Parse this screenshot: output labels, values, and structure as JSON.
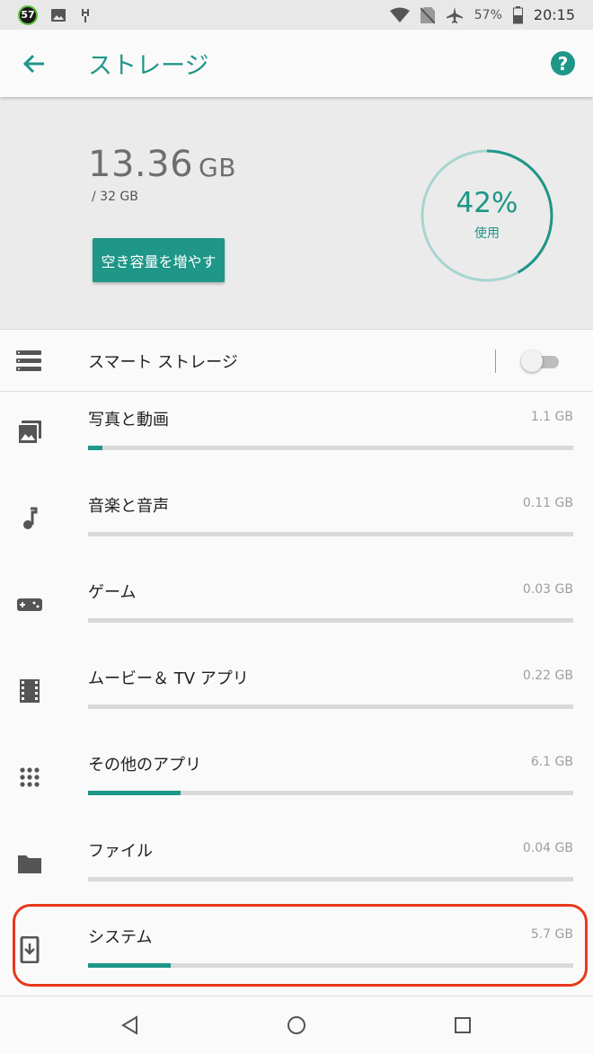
{
  "status_bar": {
    "badge": "57",
    "battery_pct": "57%",
    "time": "20:15",
    "icons": [
      "badge-icon",
      "image-icon",
      "usb-icon",
      "wifi-icon",
      "no-sim-icon",
      "airplane-icon",
      "battery-icon"
    ]
  },
  "app_bar": {
    "title": "ストレージ",
    "help_glyph": "?"
  },
  "summary": {
    "used_value": "13.36",
    "used_unit": "GB",
    "total": "/ 32 GB",
    "free_up_button": "空き容量を増やす",
    "gauge_percent": "42%",
    "gauge_label": "使用",
    "gauge_fraction": 0.42
  },
  "smart_storage": {
    "label": "スマート ストレージ",
    "enabled": false
  },
  "categories": [
    {
      "label": "写真と動画",
      "size": "1.1 GB",
      "fraction": 0.03,
      "icon": "photo-icon"
    },
    {
      "label": "音楽と音声",
      "size": "0.11 GB",
      "fraction": 0.0,
      "icon": "music-note-icon"
    },
    {
      "label": "ゲーム",
      "size": "0.03 GB",
      "fraction": 0.0,
      "icon": "gamepad-icon"
    },
    {
      "label": "ムービー＆ TV アプリ",
      "size": "0.22 GB",
      "fraction": 0.0,
      "icon": "film-icon"
    },
    {
      "label": "その他のアプリ",
      "size": "6.1 GB",
      "fraction": 0.19,
      "icon": "apps-grid-icon"
    },
    {
      "label": "ファイル",
      "size": "0.04 GB",
      "fraction": 0.0,
      "icon": "folder-icon"
    },
    {
      "label": "システム",
      "size": "5.7 GB",
      "fraction": 0.17,
      "icon": "system-update-icon"
    }
  ],
  "colors": {
    "accent": "#1e9688",
    "highlight": "#e8391c"
  }
}
